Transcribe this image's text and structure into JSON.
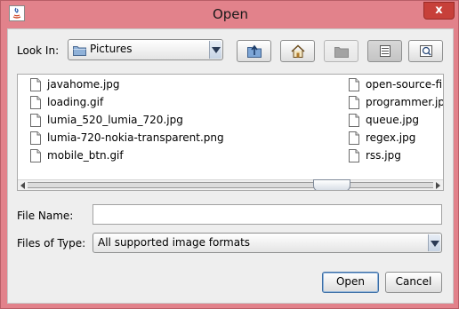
{
  "window": {
    "title": "Open",
    "close_glyph": "x"
  },
  "toolbar": {
    "look_in_label": "Look In:",
    "look_in_value": "Pictures",
    "buttons": [
      {
        "icon": "up-one-level-icon"
      },
      {
        "icon": "home-icon"
      },
      {
        "icon": "new-folder-icon",
        "disabled": true
      },
      {
        "icon": "list-view-icon",
        "pressed": true
      },
      {
        "icon": "details-view-icon"
      }
    ]
  },
  "files": {
    "column1": [
      "javahome.jpg",
      "loading.gif",
      "lumia_520_lumia_720.jpg",
      "lumia-720-nokia-transparent.png",
      "mobile_btn.gif"
    ],
    "column2": [
      "open-source-firm",
      "programmer.jpg",
      "queue.jpg",
      "regex.jpg",
      "rss.jpg"
    ]
  },
  "form": {
    "file_name_label": "File Name:",
    "file_name_value": "",
    "file_type_label": "Files of Type:",
    "file_type_value": "All supported image formats"
  },
  "actions": {
    "open_label": "Open",
    "cancel_label": "Cancel"
  },
  "colors": {
    "frame": "#e2828b",
    "close_button": "#c7403a",
    "default_button_border": "#3c6ea5"
  }
}
